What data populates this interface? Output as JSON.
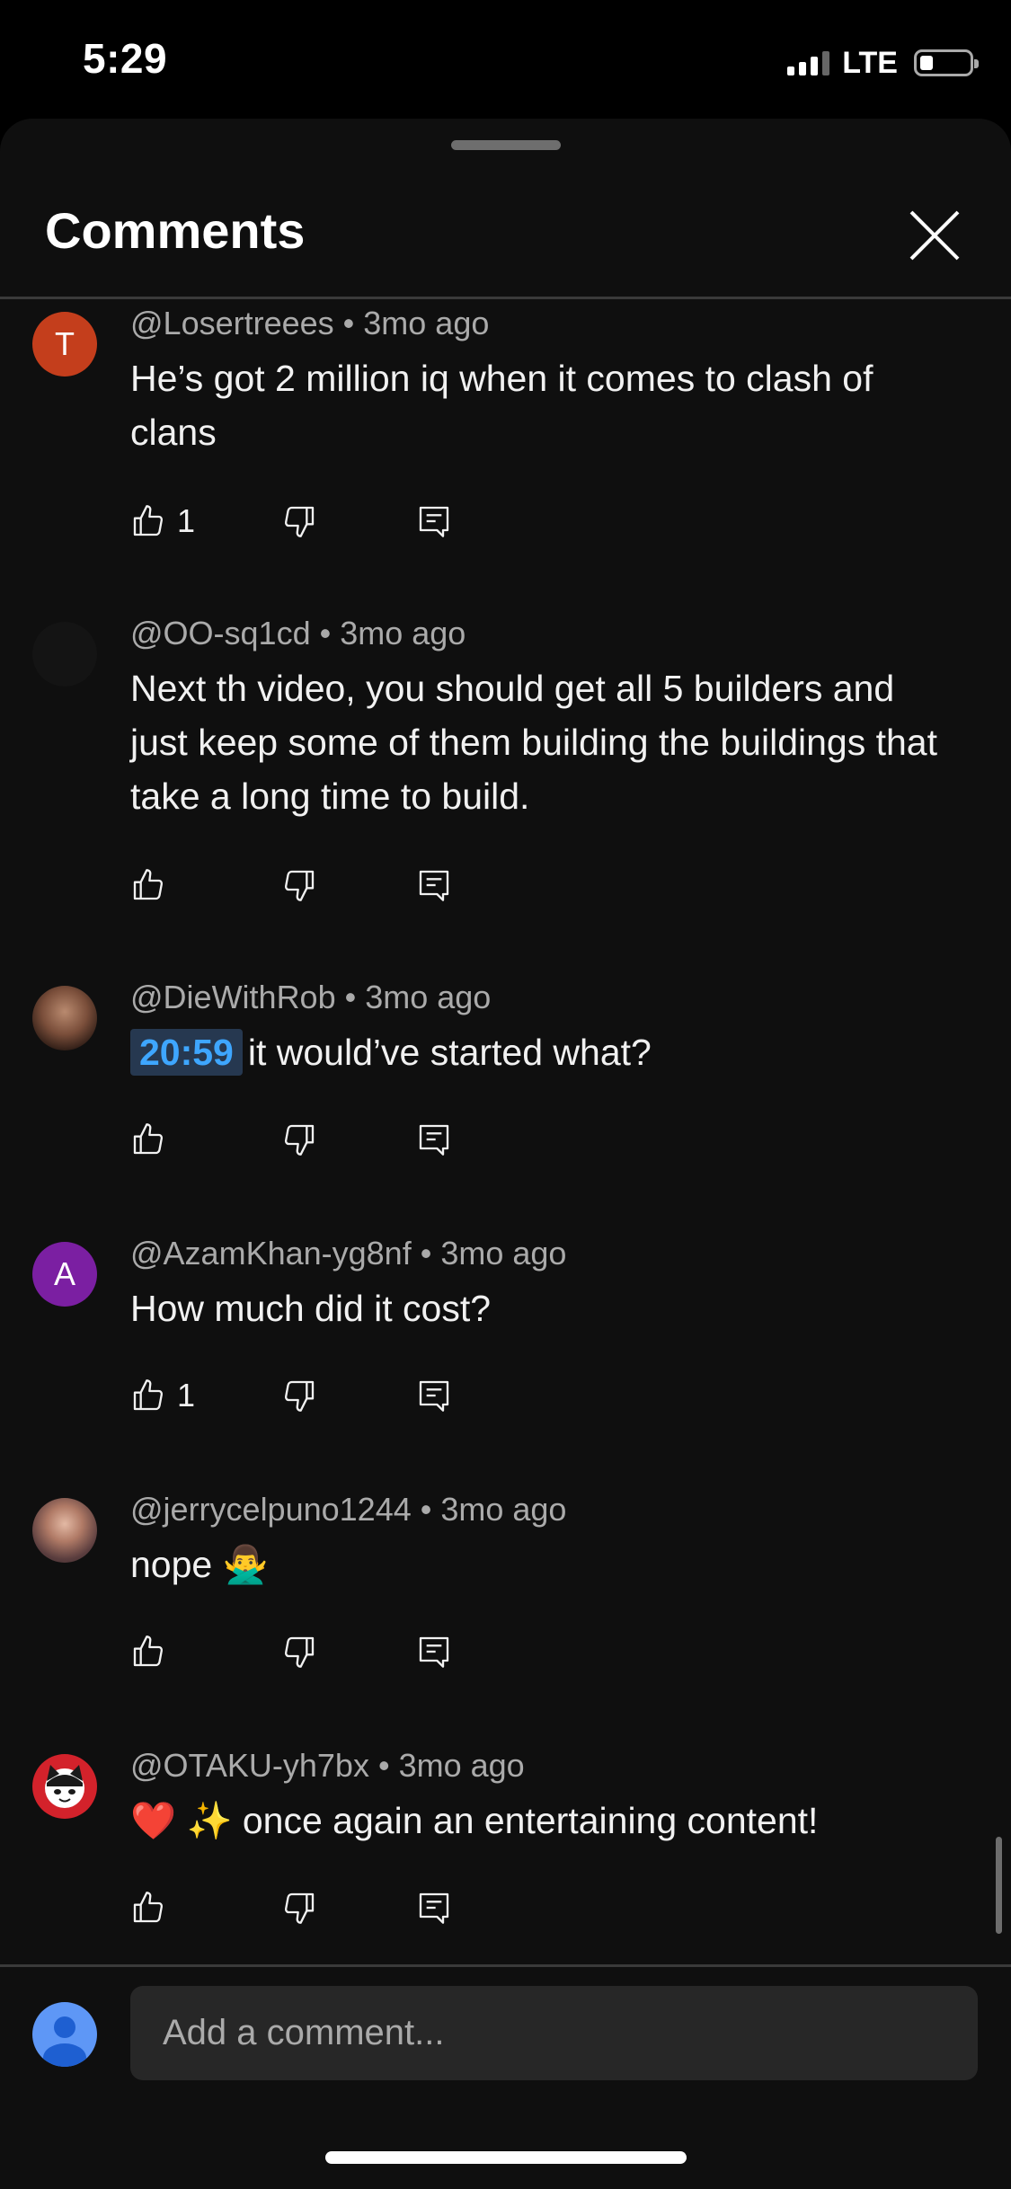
{
  "status_bar": {
    "time": "5:29",
    "network": "LTE"
  },
  "sheet": {
    "title": "Comments"
  },
  "comments": [
    {
      "author": "@Losertreees",
      "age": "3mo ago",
      "avatar_letter": "T",
      "avatar_color": "#c43e1c",
      "text": "He’s got 2 million iq when it comes to clash of clans",
      "likes": "1"
    },
    {
      "author": "@OO-sq1cd",
      "age": "3mo ago",
      "text": "Next th video, you should get all 5 builders and just keep some of them building the buildings that take a long time to build.",
      "likes": ""
    },
    {
      "author": "@DieWithRob",
      "age": "3mo ago",
      "timestamp": "20:59",
      "text": "it would’ve started what?",
      "likes": ""
    },
    {
      "author": "@AzamKhan-yg8nf",
      "age": "3mo ago",
      "avatar_letter": "A",
      "avatar_color": "#7b1fa2",
      "text": "How much did it cost?",
      "likes": "1"
    },
    {
      "author": "@jerrycelpuno1244",
      "age": "3mo ago",
      "text": "nope 🙅‍♂️",
      "likes": ""
    },
    {
      "author": "@OTAKU-yh7bx",
      "age": "3mo ago",
      "text": "❤️ ✨ once again an entertaining content!",
      "likes": ""
    }
  ],
  "composer": {
    "placeholder": "Add a comment..."
  },
  "colors": {
    "background": "#0f0f0f",
    "timestamp_link": "#3ea6ff",
    "user_avatar": "#5e97f6"
  },
  "icons": [
    "close-icon",
    "thumbs-up-icon",
    "thumbs-down-icon",
    "reply-icon",
    "user-icon"
  ]
}
